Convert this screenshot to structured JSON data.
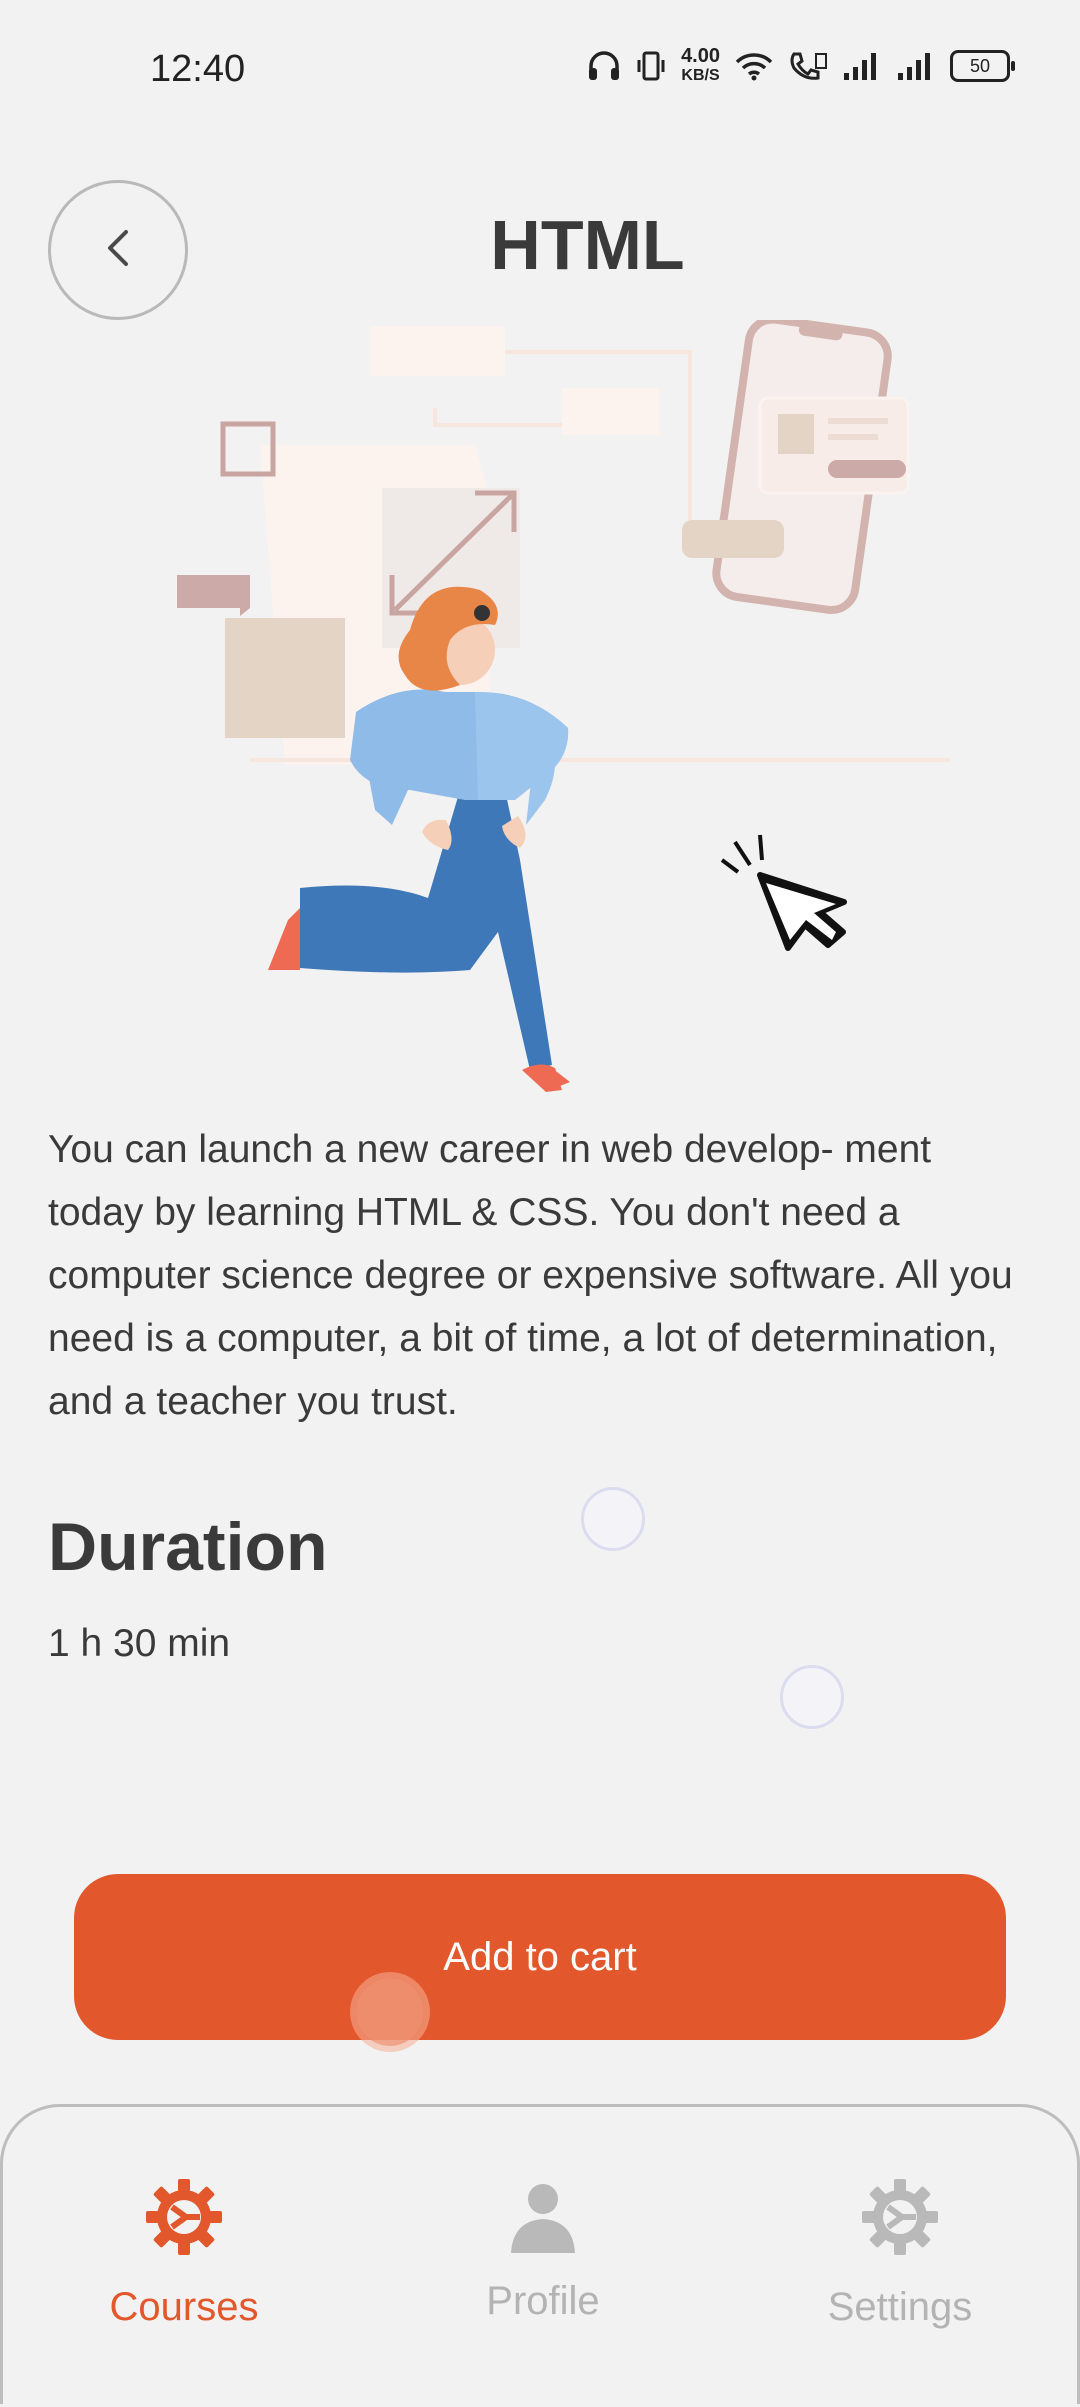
{
  "status_bar": {
    "time": "12:40",
    "net_speed_value": "4.00",
    "net_speed_unit": "KB/S",
    "battery": "50",
    "icons": [
      "headphones-icon",
      "vibrate-icon",
      "wifi-icon",
      "volte-call-icon",
      "signal-icon",
      "signal-icon"
    ]
  },
  "header": {
    "back_icon": "chevron-left-icon",
    "title": "HTML"
  },
  "course": {
    "description_lines": [
      "You can launch a new career in web develop- ment",
      "today by learning HTML & CSS. You don't need a",
      "computer science degree or expensive software. All you",
      "need is a computer, a bit of time, a lot of determination,",
      "and a teacher you trust."
    ],
    "duration_title": "Duration",
    "duration_value": "1 h 30 min"
  },
  "actions": {
    "add_to_cart_label": "Add to cart"
  },
  "bottom_nav": {
    "active": "Courses",
    "items": [
      {
        "label": "Courses",
        "icon": "gear-icon"
      },
      {
        "label": "Profile",
        "icon": "person-icon"
      },
      {
        "label": "Settings",
        "icon": "gear-icon"
      }
    ]
  },
  "colors": {
    "accent": "#e2572b",
    "background": "#f2f2f2",
    "text": "#3a3a3a",
    "inactive": "#b3b3b3"
  }
}
